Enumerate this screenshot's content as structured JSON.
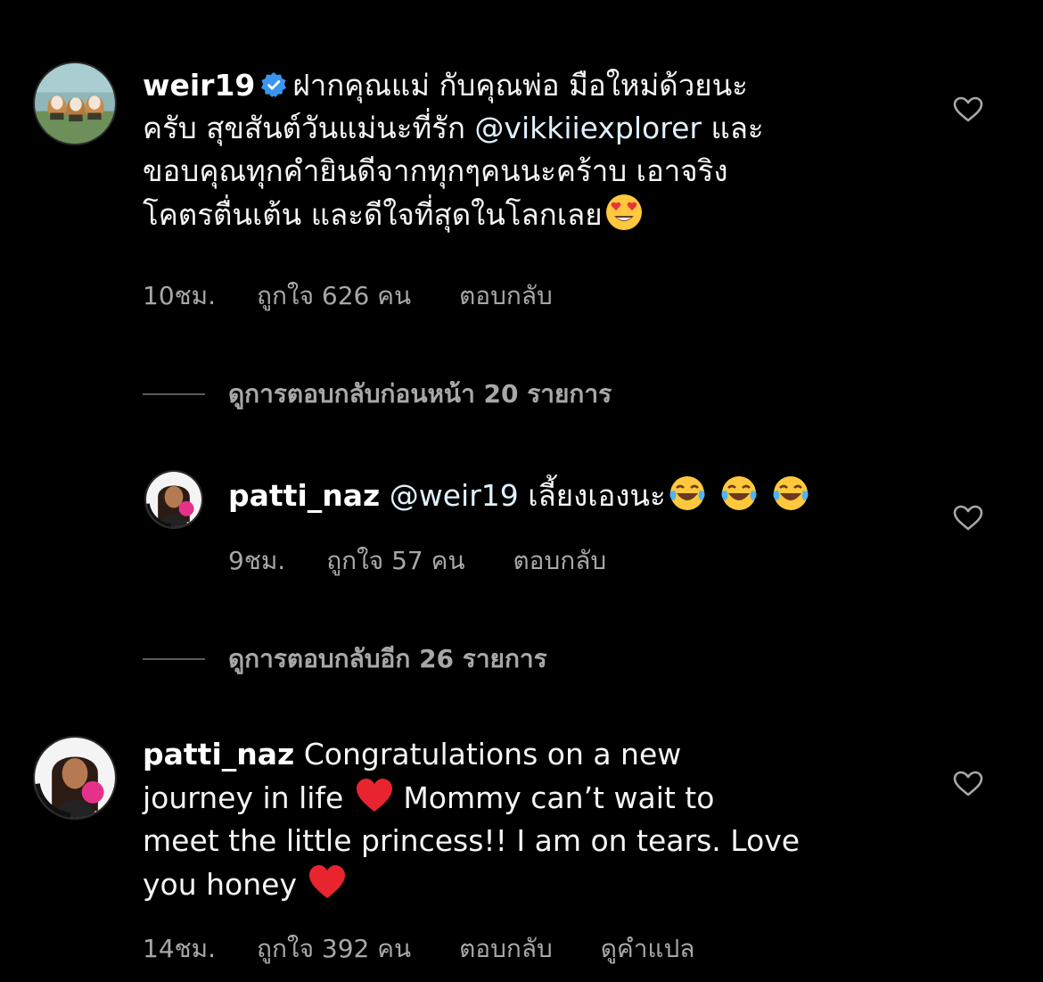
{
  "comments": [
    {
      "username": "weir19",
      "verified": true,
      "lines": [
        "ฝากคุณแม่ กับคุณพ่อ มือใหม่ด้วยนะ",
        "ครับ สุขสันต์วันแม่นะที่รัก ",
        "@vikkiiexplorer",
        " และ",
        "ขอบคุณทุกคำยินดีจากทุกๆคนนะคร้าบ เอาจริง",
        "โคตรตื่นเต้น และดีใจที่สุดในโลกเลย"
      ],
      "time": "10ชม.",
      "likes": "ถูกใจ 626 คน",
      "reply": "ตอบกลับ",
      "avatar_icon": "beagle-dogs-avatar",
      "end_emoji": "heart-eyes-emoji"
    },
    {
      "username": "patti_naz",
      "mention": "@weir19",
      "text": " เลี้ยงเองนะ",
      "time": "9ชม.",
      "likes": "ถูกใจ 57 คน",
      "reply": "ตอบกลับ",
      "avatar_icon": "woman-vaccinated-avatar",
      "emojis": [
        "laughing-tears-emoji",
        "laughing-tears-emoji",
        "laughing-tears-emoji"
      ]
    },
    {
      "username": "patti_naz",
      "lines": [
        " Congratulations on a new",
        "journey in life ",
        " Mommy can’t wait to",
        "meet the little princess!! I am on tears. Love",
        "you honey "
      ],
      "time": "14ชม.",
      "likes": "ถูกใจ 392 คน",
      "reply": "ตอบกลับ",
      "translate": "ดูคำแปล",
      "avatar_icon": "woman-vaccinated-avatar",
      "emojis": [
        "red-heart-emoji",
        "red-heart-emoji"
      ]
    }
  ],
  "view_previous_replies": "ดูการตอบกลับก่อนหน้า 20 รายการ",
  "view_more_replies": "ดูการตอบกลับอีก 26 รายการ",
  "colors": {
    "background": "#000000",
    "text": "#f5f5f5",
    "secondary": "#a8a8a8",
    "verified": "#3797f0",
    "mention": "#e0f1ff"
  }
}
